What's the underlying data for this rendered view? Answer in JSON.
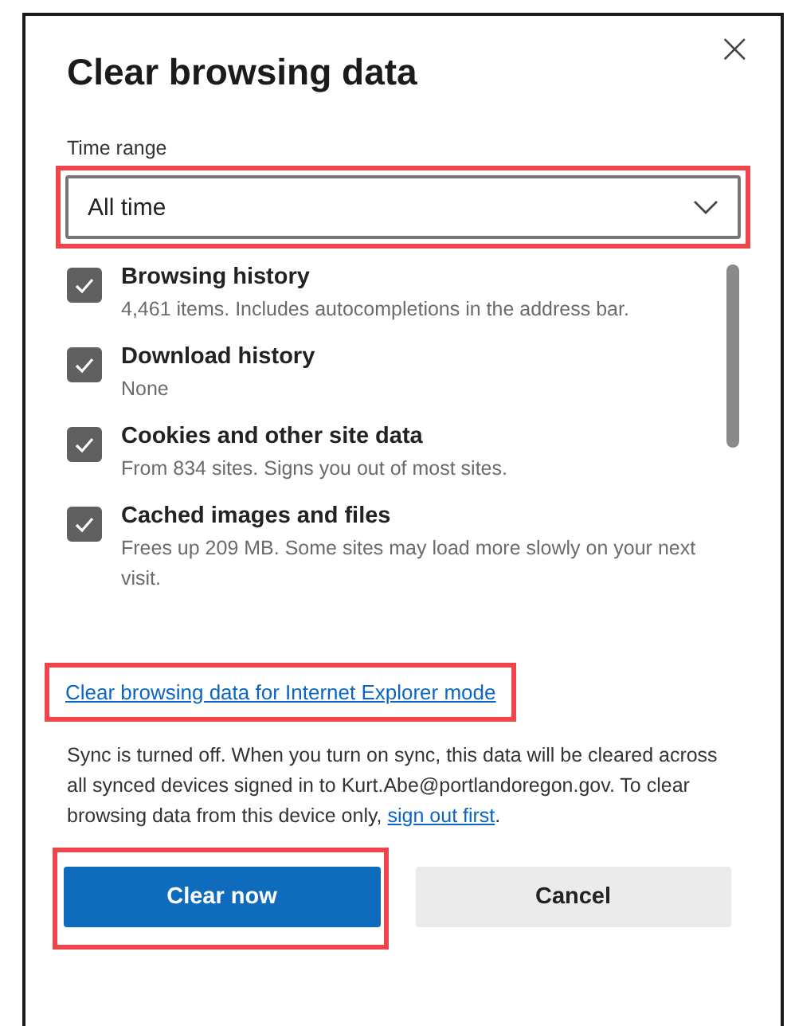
{
  "dialog": {
    "title": "Clear browsing data",
    "close_symbol": "×"
  },
  "time_range": {
    "label": "Time range",
    "value": "All time",
    "highlighted": true
  },
  "options": [
    {
      "label": "Browsing history",
      "description": "4,461 items. Includes autocompletions in the address bar.",
      "checked": true
    },
    {
      "label": "Download history",
      "description": "None",
      "checked": true
    },
    {
      "label": "Cookies and other site data",
      "description": "From 834 sites. Signs you out of most sites.",
      "checked": true
    },
    {
      "label": "Cached images and files",
      "description": "Frees up 209 MB. Some sites may load more slowly on your next visit.",
      "checked": true
    }
  ],
  "ie_link": {
    "text": "Clear browsing data for Internet Explorer mode",
    "highlighted": true
  },
  "sync_notice": {
    "text": "Sync is turned off. When you turn on sync, this data will be cleared across all synced devices signed in to Kurt.Abe@portlandoregon.gov. To clear browsing data from this device only, ",
    "link": "sign out first",
    "after": "."
  },
  "buttons": [
    {
      "label": "Clear now",
      "kind": "primary",
      "highlighted": true
    },
    {
      "label": "Cancel",
      "kind": "secondary",
      "highlighted": false
    }
  ]
}
